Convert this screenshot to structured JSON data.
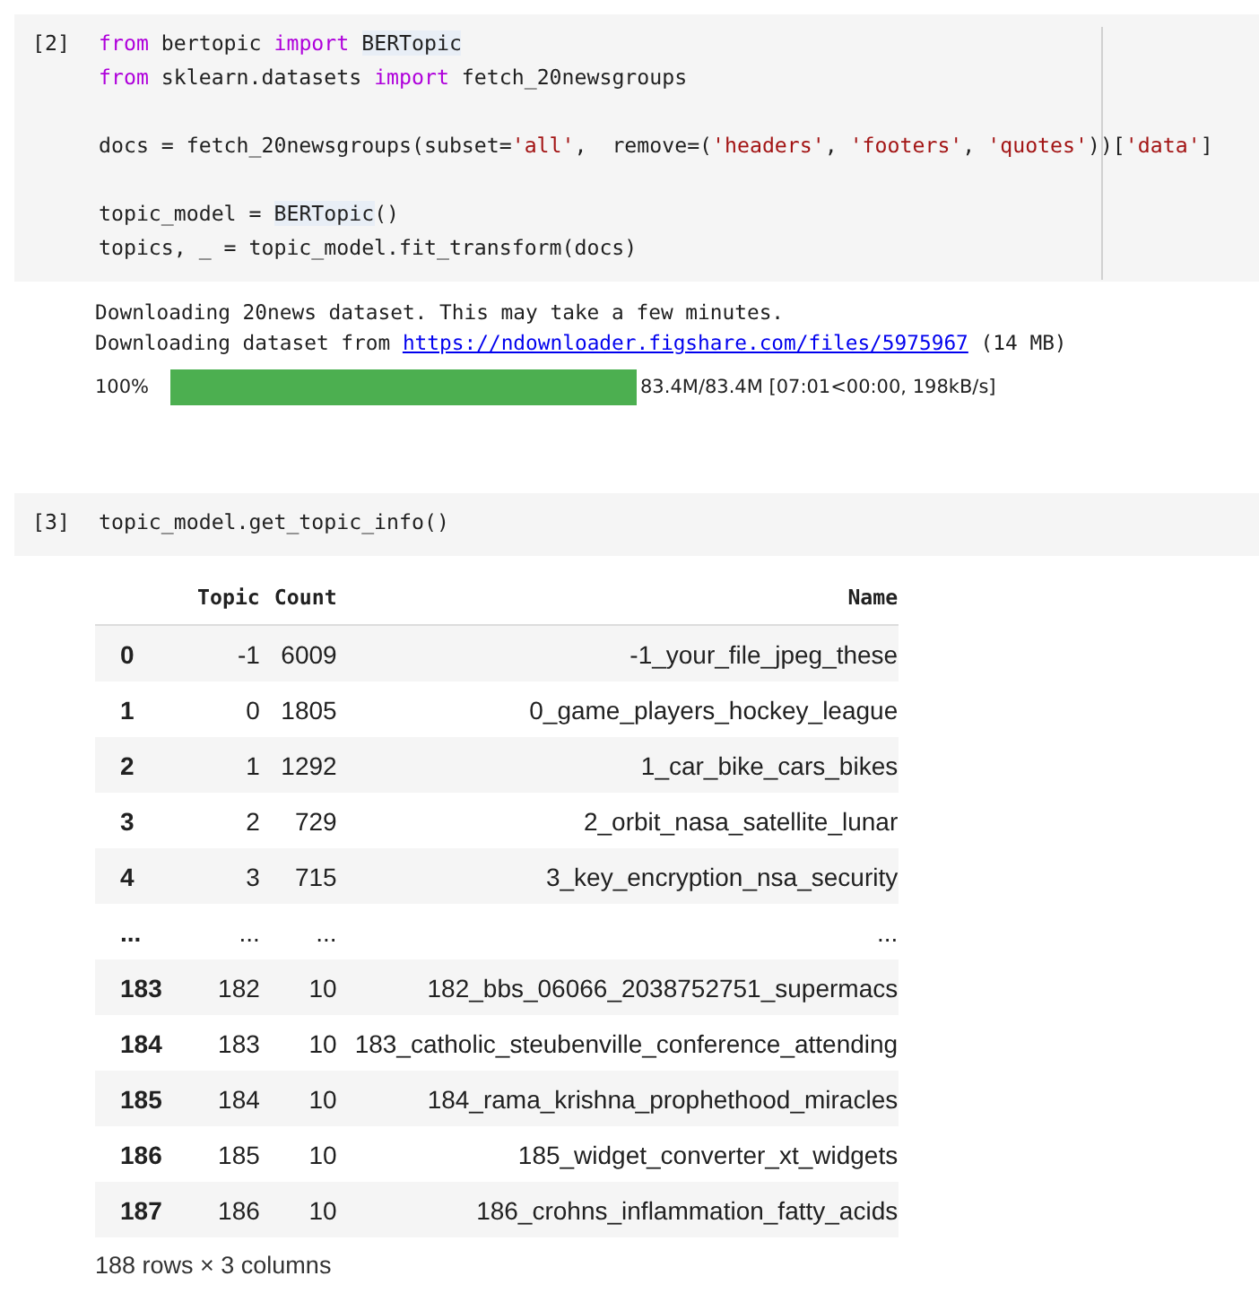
{
  "cells": [
    {
      "prompt": "[2]",
      "lines": [
        {
          "tokens": [
            {
              "text": "from",
              "kind": "kw"
            },
            {
              "text": " bertopic ",
              "kind": "plain"
            },
            {
              "text": "import ",
              "kind": "kw"
            },
            {
              "text": "BERTopic",
              "kind": "match"
            }
          ]
        },
        {
          "tokens": [
            {
              "text": "from",
              "kind": "kw"
            },
            {
              "text": " sklearn.datasets ",
              "kind": "plain"
            },
            {
              "text": "import",
              "kind": "kw"
            },
            {
              "text": " fetch_20newsgroups",
              "kind": "plain"
            }
          ]
        },
        {
          "kind": "blank"
        },
        {
          "tokens": [
            {
              "text": "docs = fetch_20newsgroups(subset=",
              "kind": "plain"
            },
            {
              "text": "'all'",
              "kind": "str"
            },
            {
              "text": ",  remove=(",
              "kind": "plain"
            },
            {
              "text": "'headers'",
              "kind": "str"
            },
            {
              "text": ", ",
              "kind": "plain"
            },
            {
              "text": "'footers'",
              "kind": "str"
            },
            {
              "text": ", ",
              "kind": "plain"
            },
            {
              "text": "'quotes'",
              "kind": "str"
            },
            {
              "text": "))[",
              "kind": "plain"
            },
            {
              "text": "'data'",
              "kind": "str"
            },
            {
              "text": "]",
              "kind": "plain"
            }
          ]
        },
        {
          "kind": "blank"
        },
        {
          "tokens": [
            {
              "text": "topic_model = ",
              "kind": "plain"
            },
            {
              "text": "BERTopic",
              "kind": "match"
            },
            {
              "text": "()",
              "kind": "plain"
            }
          ]
        },
        {
          "tokens": [
            {
              "text": "topics, _ = topic_model.fit_transform(docs)",
              "kind": "plain"
            }
          ]
        }
      ],
      "output": {
        "lines": [
          "Downloading 20news dataset. This may take a few minutes."
        ],
        "link_line": {
          "before": "Downloading dataset from ",
          "link": "https://ndownloader.figshare.com/files/5975967",
          "after": " (14 MB)"
        },
        "progress": {
          "percent": "100%",
          "level": 1.0,
          "reading": "83.4M/83.4M [07:01<00:00, 198kB/s]"
        }
      }
    },
    {
      "prompt": "[3]",
      "lines": [
        {
          "tokens": [
            {
              "text": "topic_model.get_topic_info()",
              "kind": "plain"
            }
          ]
        }
      ],
      "table": {
        "columns": [
          "Topic",
          "Count",
          "Name"
        ],
        "rows": [
          {
            "index": "0",
            "cells": [
              "-1",
              "6009",
              "-1_your_file_jpeg_these"
            ]
          },
          {
            "index": "1",
            "cells": [
              "0",
              "1805",
              "0_game_players_hockey_league"
            ]
          },
          {
            "index": "2",
            "cells": [
              "1",
              "1292",
              "1_car_bike_cars_bikes"
            ]
          },
          {
            "index": "3",
            "cells": [
              "2",
              "729",
              "2_orbit_nasa_satellite_lunar"
            ]
          },
          {
            "index": "4",
            "cells": [
              "3",
              "715",
              "3_key_encryption_nsa_security"
            ]
          },
          {
            "index": "...",
            "cells": [
              "...",
              "...",
              "..."
            ]
          },
          {
            "index": "183",
            "cells": [
              "182",
              "10",
              "182_bbs_06066_2038752751_supermacs"
            ]
          },
          {
            "index": "184",
            "cells": [
              "183",
              "10",
              "183_catholic_steubenville_conference_attending"
            ]
          },
          {
            "index": "185",
            "cells": [
              "184",
              "10",
              "184_rama_krishna_prophethood_miracles"
            ]
          },
          {
            "index": "186",
            "cells": [
              "185",
              "10",
              "185_widget_converter_xt_widgets"
            ]
          },
          {
            "index": "187",
            "cells": [
              "186",
              "10",
              "186_crohns_inflammation_fatty_acids"
            ]
          }
        ],
        "footer": "188 rows × 3 columns"
      }
    }
  ]
}
